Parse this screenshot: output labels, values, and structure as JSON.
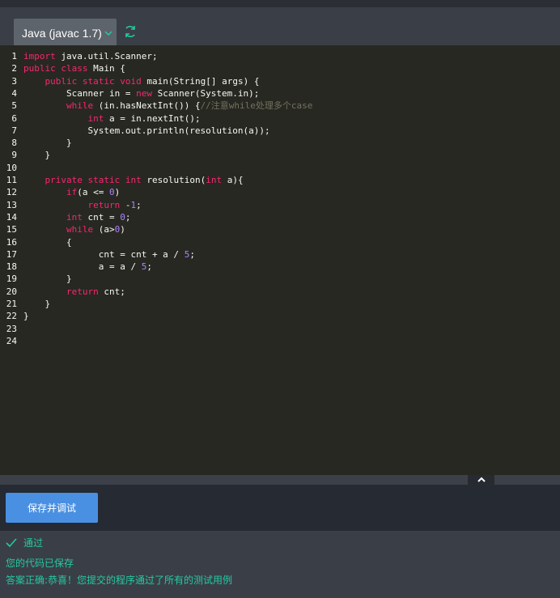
{
  "toolbar": {
    "language_label": "Java (javac 1.7)"
  },
  "editor": {
    "lines": [
      {
        "n": "1",
        "tokens": [
          {
            "t": "import",
            "c": "kw"
          },
          {
            "t": " java.util.Scanner;",
            "c": ""
          }
        ]
      },
      {
        "n": "2",
        "tokens": [
          {
            "t": "public",
            "c": "kw"
          },
          {
            "t": " ",
            "c": ""
          },
          {
            "t": "class",
            "c": "kw"
          },
          {
            "t": " Main {",
            "c": ""
          }
        ]
      },
      {
        "n": "3",
        "tokens": [
          {
            "t": "    ",
            "c": ""
          },
          {
            "t": "public",
            "c": "kw"
          },
          {
            "t": " ",
            "c": ""
          },
          {
            "t": "static",
            "c": "kw"
          },
          {
            "t": " ",
            "c": ""
          },
          {
            "t": "void",
            "c": "kw"
          },
          {
            "t": " main(String[] args) {",
            "c": ""
          }
        ]
      },
      {
        "n": "4",
        "tokens": [
          {
            "t": "        Scanner in = ",
            "c": ""
          },
          {
            "t": "new",
            "c": "kw"
          },
          {
            "t": " Scanner(System.in);",
            "c": ""
          }
        ]
      },
      {
        "n": "5",
        "tokens": [
          {
            "t": "        ",
            "c": ""
          },
          {
            "t": "while",
            "c": "kw"
          },
          {
            "t": " (in.hasNextInt()) {",
            "c": ""
          },
          {
            "t": "//注意while处理多个case",
            "c": "cm"
          }
        ]
      },
      {
        "n": "6",
        "tokens": [
          {
            "t": "            ",
            "c": ""
          },
          {
            "t": "int",
            "c": "kw"
          },
          {
            "t": " a = in.nextInt();",
            "c": ""
          }
        ]
      },
      {
        "n": "7",
        "tokens": [
          {
            "t": "            System.out.println(resolution(a));",
            "c": ""
          }
        ]
      },
      {
        "n": "8",
        "tokens": [
          {
            "t": "        }",
            "c": ""
          }
        ]
      },
      {
        "n": "9",
        "tokens": [
          {
            "t": "    }",
            "c": ""
          }
        ]
      },
      {
        "n": "10",
        "tokens": []
      },
      {
        "n": "11",
        "tokens": [
          {
            "t": "    ",
            "c": ""
          },
          {
            "t": "private",
            "c": "kw"
          },
          {
            "t": " ",
            "c": ""
          },
          {
            "t": "static",
            "c": "kw"
          },
          {
            "t": " ",
            "c": ""
          },
          {
            "t": "int",
            "c": "kw"
          },
          {
            "t": " resolution(",
            "c": ""
          },
          {
            "t": "int",
            "c": "kw"
          },
          {
            "t": " a){",
            "c": ""
          }
        ]
      },
      {
        "n": "12",
        "tokens": [
          {
            "t": "        ",
            "c": ""
          },
          {
            "t": "if",
            "c": "kw"
          },
          {
            "t": "(a <= ",
            "c": ""
          },
          {
            "t": "0",
            "c": "num"
          },
          {
            "t": ")",
            "c": ""
          }
        ]
      },
      {
        "n": "13",
        "tokens": [
          {
            "t": "            ",
            "c": ""
          },
          {
            "t": "return",
            "c": "kw"
          },
          {
            "t": " -",
            "c": ""
          },
          {
            "t": "1",
            "c": "num"
          },
          {
            "t": ";",
            "c": ""
          }
        ]
      },
      {
        "n": "14",
        "tokens": [
          {
            "t": "        ",
            "c": ""
          },
          {
            "t": "int",
            "c": "kw"
          },
          {
            "t": " cnt = ",
            "c": ""
          },
          {
            "t": "0",
            "c": "num"
          },
          {
            "t": ";",
            "c": ""
          }
        ]
      },
      {
        "n": "15",
        "tokens": [
          {
            "t": "        ",
            "c": ""
          },
          {
            "t": "while",
            "c": "kw"
          },
          {
            "t": " (a>",
            "c": ""
          },
          {
            "t": "0",
            "c": "num"
          },
          {
            "t": ")",
            "c": ""
          }
        ]
      },
      {
        "n": "16",
        "tokens": [
          {
            "t": "        {",
            "c": ""
          }
        ]
      },
      {
        "n": "17",
        "tokens": [
          {
            "t": "              cnt = cnt + a / ",
            "c": ""
          },
          {
            "t": "5",
            "c": "num"
          },
          {
            "t": ";",
            "c": ""
          }
        ]
      },
      {
        "n": "18",
        "tokens": [
          {
            "t": "              a = a / ",
            "c": ""
          },
          {
            "t": "5",
            "c": "num"
          },
          {
            "t": ";",
            "c": ""
          }
        ]
      },
      {
        "n": "19",
        "tokens": [
          {
            "t": "        }",
            "c": ""
          }
        ]
      },
      {
        "n": "20",
        "tokens": [
          {
            "t": "        ",
            "c": ""
          },
          {
            "t": "return",
            "c": "kw"
          },
          {
            "t": " cnt;",
            "c": ""
          }
        ]
      },
      {
        "n": "21",
        "tokens": [
          {
            "t": "    }",
            "c": ""
          }
        ]
      },
      {
        "n": "22",
        "tokens": [
          {
            "t": "}",
            "c": ""
          }
        ]
      },
      {
        "n": "23",
        "tokens": []
      },
      {
        "n": "24",
        "tokens": []
      }
    ]
  },
  "actions": {
    "save_debug_label": "保存并调试"
  },
  "result": {
    "status_label": "通过",
    "saved_msg": "您的代码已保存",
    "answer_msg": "答案正确:恭喜！您提交的程序通过了所有的测试用例"
  },
  "colors": {
    "keyword": "#f92672",
    "number": "#ae81ff",
    "comment": "#75715e",
    "success": "#26c9a1",
    "button": "#4a90e2"
  }
}
